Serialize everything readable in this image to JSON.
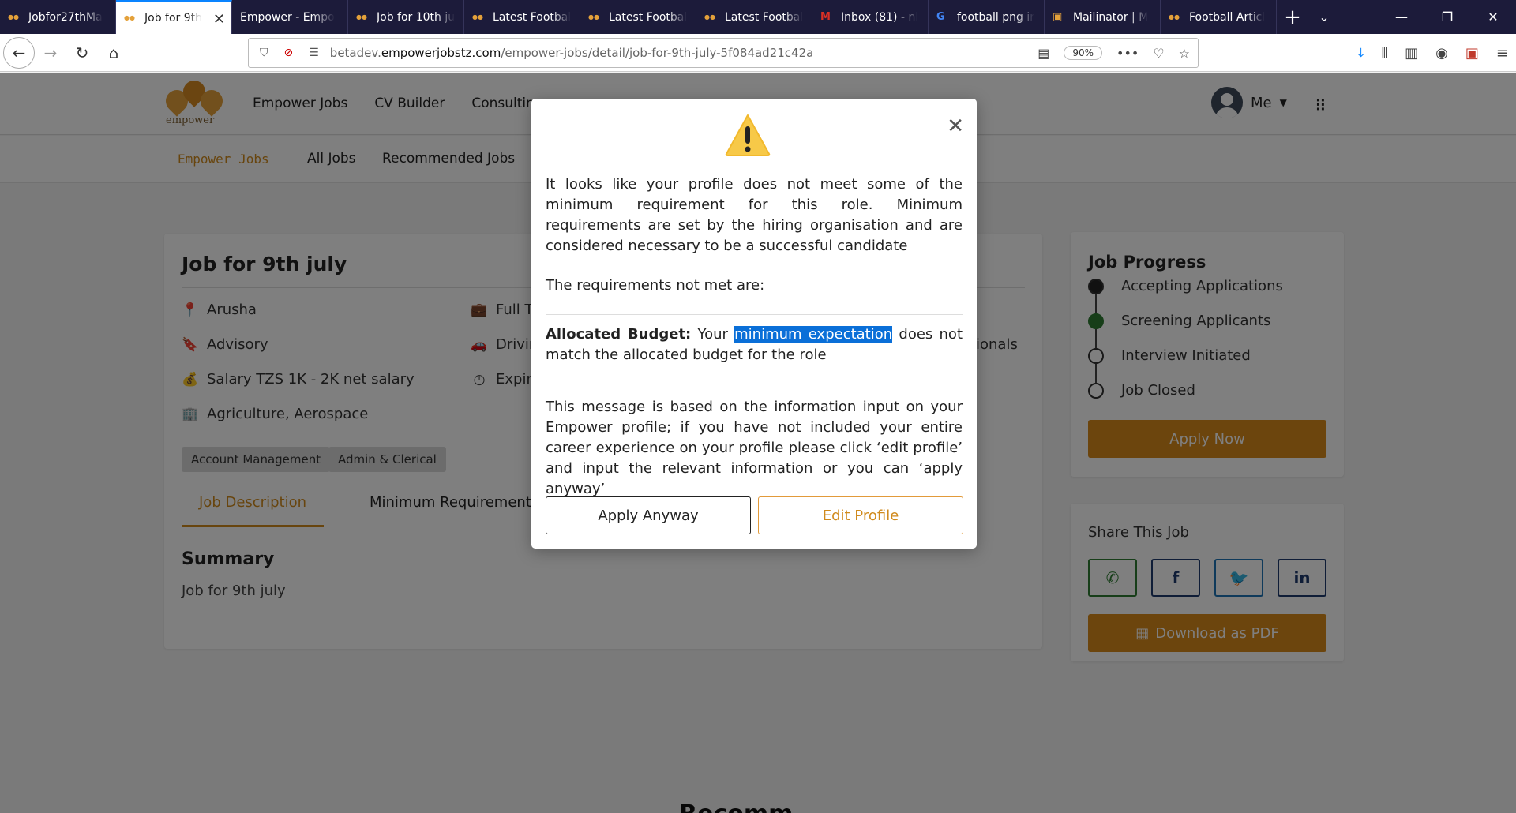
{
  "browser": {
    "tabs": [
      {
        "title": "Jobfor27thMa",
        "active": false,
        "icon": "empower-favicon"
      },
      {
        "title": "Job for 9th",
        "active": true,
        "icon": "empower-favicon"
      },
      {
        "title": "Empower - Empo",
        "active": false,
        "icon": "none"
      },
      {
        "title": "Job for 10th ju",
        "active": false,
        "icon": "empower-favicon"
      },
      {
        "title": "Latest Footbal",
        "active": false,
        "icon": "empower-favicon"
      },
      {
        "title": "Latest Footbal",
        "active": false,
        "icon": "empower-favicon"
      },
      {
        "title": "Latest Footbal",
        "active": false,
        "icon": "empower-favicon"
      },
      {
        "title": "Inbox (81) - nl",
        "active": false,
        "icon": "gmail-icon"
      },
      {
        "title": "football png ir",
        "active": false,
        "icon": "google-icon"
      },
      {
        "title": "Mailinator | M",
        "active": false,
        "icon": "mailinator-icon"
      },
      {
        "title": "Football Articl",
        "active": false,
        "icon": "empower-favicon"
      }
    ],
    "url_prefix": "betadev.",
    "url_domain": "empowerjobstz.com",
    "url_path": "/empower-jobs/detail/job-for-9th-july-5f084ad21c42a",
    "zoom": "90%"
  },
  "site": {
    "logo_text": "empower",
    "main_nav": [
      "Empower Jobs",
      "CV Builder",
      "Consulting"
    ],
    "user_label": "Me",
    "sub_nav_brand": "Empower Jobs",
    "sub_nav": [
      "All Jobs",
      "Recommended Jobs"
    ]
  },
  "job": {
    "title": "Job for 9th july",
    "location": "Arusha",
    "type_partial": "Full T",
    "category": "Advisory",
    "driving_partial": "Drivin",
    "salary": "Salary TZS 1K - 2K net salary",
    "expiry_partial": "Expir",
    "industry": "Agriculture, Aerospace",
    "right_partial": "ionals",
    "tags": [
      "Account Management",
      "Admin & Clerical"
    ],
    "tabs": [
      "Job Description",
      "Minimum Requirements"
    ],
    "summary_heading": "Summary",
    "summary_text": "Job for 9th july"
  },
  "progress": {
    "title": "Job Progress",
    "steps": [
      {
        "label": "Accepting Applications",
        "state": "done"
      },
      {
        "label": "Screening Applicants",
        "state": "current"
      },
      {
        "label": "Interview Initiated",
        "state": "pending"
      },
      {
        "label": "Job Closed",
        "state": "pending"
      }
    ],
    "apply_label": "Apply Now"
  },
  "share": {
    "title": "Share This Job",
    "buttons": [
      "whatsapp",
      "facebook",
      "twitter",
      "linkedin"
    ],
    "pdf_label": "Download as PDF"
  },
  "modal": {
    "intro": "It looks like your profile does not meet some of the minimum requirement for this role. Minimum requirements are set by the hiring organisation and are considered necessary to be a successful candidate",
    "requirements_heading": "The requirements not met are:",
    "req_label": "Allocated Budget:",
    "req_text_before": "Your",
    "req_text_selected": "minimum expectation",
    "req_text_after": "does not match the allocated budget for the role",
    "footer": "This message is based on the information input on your Empower profile; if you have not included your entire career experience on your profile please click ‘edit profile’ and input the relevant information or you can ‘apply anyway’",
    "apply_anyway": "Apply Anyway",
    "edit_profile": "Edit Profile"
  },
  "page_bottom_partial": "Recomm"
}
